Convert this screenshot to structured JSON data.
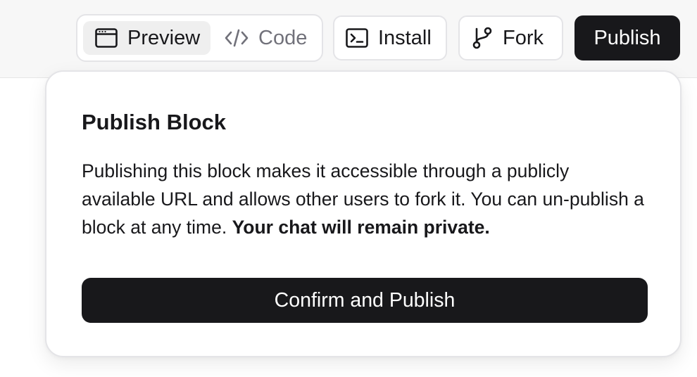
{
  "toolbar": {
    "view_toggle": {
      "preview_label": "Preview",
      "code_label": "Code",
      "selected": "Preview"
    },
    "install_label": "Install",
    "fork_label": "Fork",
    "publish_label": "Publish"
  },
  "publish_popover": {
    "title": "Publish Block",
    "description": "Publishing this block makes it accessible through a publicly available URL and allows other users to fork it. You can un-publish a block at any time.",
    "description_emphasis": "Your chat will remain private.",
    "confirm_label": "Confirm and Publish"
  },
  "icons": {
    "preview": "browser-window-icon",
    "code": "code-brackets-icon",
    "install": "terminal-icon",
    "fork": "git-fork-icon"
  },
  "colors": {
    "primary": "#18181b",
    "border": "#e4e4e7",
    "muted_text": "#71717a",
    "topbar_bg": "#f7f7f7"
  }
}
